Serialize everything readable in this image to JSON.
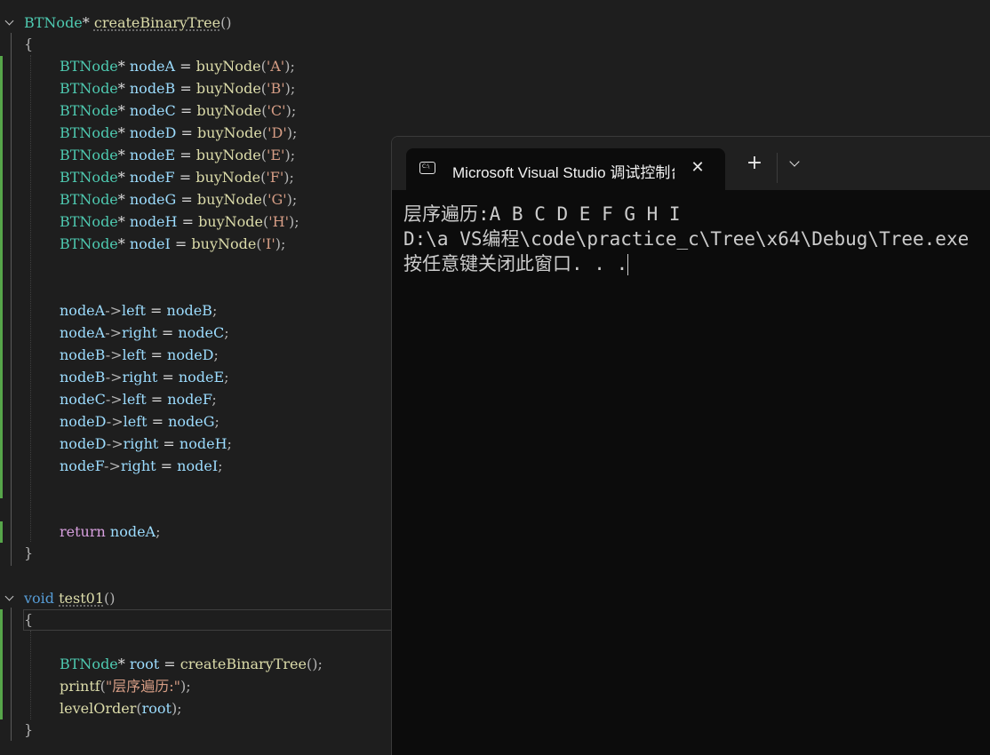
{
  "editor": {
    "func1": {
      "ret_type": "BTNode",
      "star": "*",
      "name": "createBinaryTree",
      "parens": "()",
      "open": "{",
      "close": "}",
      "nodes": [
        {
          "var": "nodeA",
          "arg": "'A'"
        },
        {
          "var": "nodeB",
          "arg": "'B'"
        },
        {
          "var": "nodeC",
          "arg": "'C'"
        },
        {
          "var": "nodeD",
          "arg": "'D'"
        },
        {
          "var": "nodeE",
          "arg": "'E'"
        },
        {
          "var": "nodeF",
          "arg": "'F'"
        },
        {
          "var": "nodeG",
          "arg": "'G'"
        },
        {
          "var": "nodeH",
          "arg": "'H'"
        },
        {
          "var": "nodeI",
          "arg": "'I'"
        }
      ],
      "decl_type": "BTNode",
      "decl_fn": "buyNode",
      "links": [
        {
          "from": "nodeA",
          "field": "left",
          "to": "nodeB"
        },
        {
          "from": "nodeA",
          "field": "right",
          "to": "nodeC"
        },
        {
          "from": "nodeB",
          "field": "left",
          "to": "nodeD"
        },
        {
          "from": "nodeB",
          "field": "right",
          "to": "nodeE"
        },
        {
          "from": "nodeC",
          "field": "left",
          "to": "nodeF"
        },
        {
          "from": "nodeD",
          "field": "left",
          "to": "nodeG"
        },
        {
          "from": "nodeD",
          "field": "right",
          "to": "nodeH"
        },
        {
          "from": "nodeF",
          "field": "right",
          "to": "nodeI"
        }
      ],
      "return_kw": "return",
      "return_val": "nodeA"
    },
    "func2": {
      "ret_type": "void",
      "name": "test01",
      "parens": "()",
      "open": "{",
      "close": "}",
      "root_type": "BTNode",
      "root_var": "root",
      "root_call": "createBinaryTree",
      "printf_fn": "printf",
      "printf_arg": "\"层序遍历:\"",
      "level_fn": "levelOrder",
      "level_arg": "root"
    }
  },
  "terminal": {
    "tab_title": "Microsoft Visual Studio 调试控制台",
    "close_glyph": "✕",
    "new_tab_glyph": "+",
    "lines": [
      "层序遍历:A B C D E F G H I",
      "D:\\a VS编程\\code\\practice_c\\Tree\\x64\\Debug\\Tree.exe",
      "按任意键关闭此窗口. . ."
    ]
  },
  "colors": {
    "editor_bg": "#1e1e1e",
    "terminal_bg": "#0c0c0c",
    "type": "#4ec9b0",
    "function": "#dcdcaa",
    "variable": "#9cdcfe",
    "char_literal": "#d69d85",
    "keyword": "#569cd6",
    "control_keyword": "#d8a0df",
    "change_bar": "#57a64a"
  }
}
